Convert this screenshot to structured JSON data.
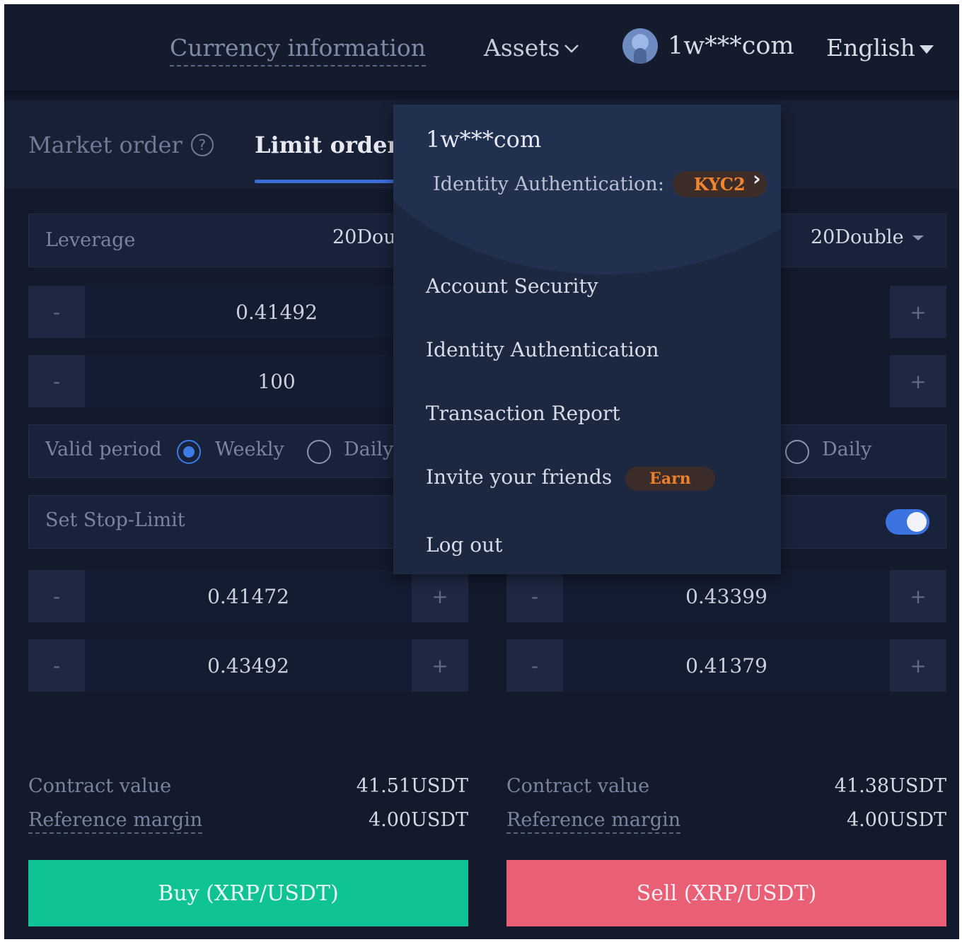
{
  "nav": {
    "currency_info": "Currency information",
    "assets": "Assets",
    "user": "1w***com",
    "language": "English"
  },
  "tabs": {
    "market_order": "Market order",
    "market_help": "?",
    "limit_order": "Limit order"
  },
  "form": {
    "leverage_label": "Leverage",
    "buy_leverage": "20Dou",
    "sell_leverage": "20Double",
    "buy_price": "0.41492",
    "buy_amount": "100",
    "minus": "-",
    "plus": "+",
    "valid_period_label": "Valid period",
    "weekly": "Weekly",
    "daily_left": "Daily",
    "daily_right": "Daily",
    "stop_limit_label": "Set Stop-Limit",
    "buy_stop_1": "0.41472",
    "buy_stop_2": "0.43492",
    "sell_stop_1": "0.43399",
    "sell_stop_2": "0.41379"
  },
  "summary": {
    "contract_value_label": "Contract value",
    "reference_margin_label": "Reference margin",
    "buy_contract_value": "41.51USDT",
    "buy_reference_margin": "4.00USDT",
    "sell_contract_value": "41.38USDT",
    "sell_reference_margin": "4.00USDT"
  },
  "buttons": {
    "buy": "Buy (XRP/USDT)",
    "sell": "Sell (XRP/USDT)"
  },
  "dropdown": {
    "user": "1w***com",
    "identity_label": "Identity Authentication:",
    "kyc_badge": "KYC2",
    "items": [
      "Account Security",
      "Identity Authentication",
      "Transaction Report",
      "Invite your friends",
      "Log out"
    ],
    "earn_badge": "Earn"
  },
  "colors": {
    "background": "#131a2c",
    "accent": "#3b6fd4",
    "buy": "#10c394",
    "sell": "#e85f76",
    "badge_orange": "#f0862f"
  }
}
